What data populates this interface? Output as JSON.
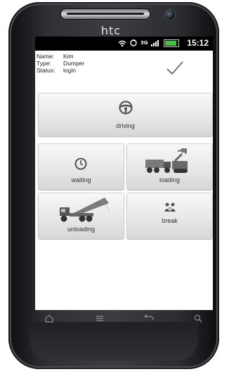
{
  "device": {
    "brand": "htc"
  },
  "status_bar": {
    "time": "15:12",
    "network": "3G"
  },
  "user": {
    "name_label": "Name:",
    "name_value": "Kim",
    "type_label": "Type:",
    "type_value": "Dumper",
    "status_label": "Status:",
    "status_value": "login"
  },
  "tiles": {
    "driving": "driving",
    "waiting": "waiting",
    "loading": "loading",
    "unloading": "unloading",
    "break": "break"
  },
  "icons": {
    "status": [
      "wifi-icon",
      "sync-icon",
      "3g-icon",
      "signal-icon",
      "battery-icon"
    ],
    "check": "checkmark-icon",
    "driving": "steering-wheel-icon",
    "waiting": "clock-icon",
    "loading": "excavator-truck-icon",
    "unloading": "tipper-truck-icon",
    "break": "people-icon",
    "nav": [
      "home-icon",
      "menu-icon",
      "back-icon",
      "search-icon"
    ]
  },
  "colors": {
    "battery": "#46c146",
    "status_bar": "#000000",
    "tile_bg": "#e6e6e6"
  }
}
